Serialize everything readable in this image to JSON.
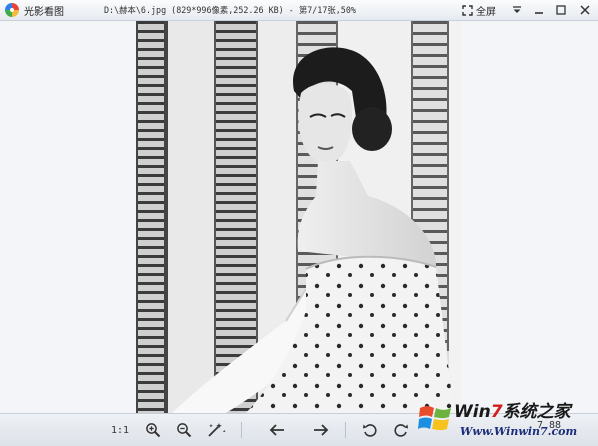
{
  "app": {
    "name": "光影看图"
  },
  "file_info": "D:\\赫本\\6.jpg (829*996像素,252.26 KB) - 第7/17张,50%",
  "window": {
    "fullscreen_label": "全屏"
  },
  "image": {
    "subject": "black-and-white-portrait-photo"
  },
  "toolbar": {
    "ratio_label": "1:1",
    "icons": [
      "zoom-in-icon",
      "zoom-out-icon",
      "magic-wand-icon",
      "previous-arrow-icon",
      "next-arrow-icon",
      "rotate-left-icon",
      "rotate-right-icon"
    ]
  },
  "watermark": {
    "brand_prefix": "Win",
    "brand_seven": "7",
    "brand_suffix": "系统之家",
    "url": "Www.Winwin7.com"
  },
  "page_count_partial": "7 88"
}
